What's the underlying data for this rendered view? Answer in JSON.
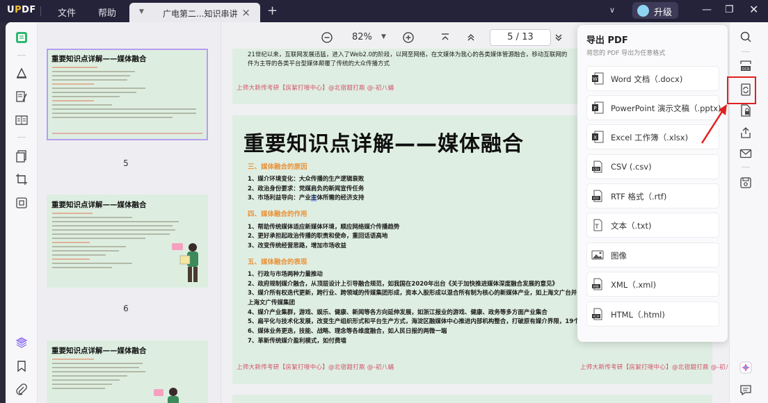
{
  "titlebar": {
    "logo": "UPDF",
    "menu": [
      "文件",
      "帮助"
    ],
    "tab_title": "广电第二...知识串讲",
    "upgrade_label": "升级"
  },
  "toolbar": {
    "zoom": "82%",
    "page_current": "5",
    "page_sep": "/",
    "page_total": "13"
  },
  "thumbnails": {
    "title": "重要知识点详解——媒体融合",
    "pages": [
      "5",
      "6"
    ]
  },
  "page_top": {
    "line1": "21世纪以来，互联网发展迅猛，进入了Web2.0的阶段，以网至网络，在文媒体为我心的各类媒体管源融合，移动互联网的",
    "line2": "件为主导的各类平台型媒体颠覆了传统的大众传播方式",
    "watermark": "上师大新传考研【房絮打嗖中心】@北宿甜打鼎 @-初八蛹"
  },
  "page_main": {
    "title": "重要知识点详解——媒体融合",
    "section1": "三、媒体融合的原因",
    "s1_items": [
      "1、媒介环境变化：大众传播的生产逻辑衰败",
      "2、政治身份要求：党媒肩负的新闻宣传任务",
      "3、市场利益导向：产业主体所需的经济支持"
    ],
    "section2": "四、媒体融合的作用",
    "s2_items": [
      "1、帮助传统媒体适应新媒体环境，顺应网络媒介传播趋势",
      "2、更好承担起政治传播的职责和使命，重回话语高地",
      "3、改变传统经营思路，增加市场收益"
    ],
    "section3": "五、媒体融合的表现",
    "s3_items": [
      "1、行政与市场两种力量推动",
      "2、政府规制媒介融合，从顶层设计上引导融合规范，如我国在2020年出台《关于加快推进媒体深度融合发展的意见》",
      "3、媒介所有权迭代更新，跨行业、跨领域的传媒集团形成，资本入股形成以混合所有制为核心的新媒体产业，如上海文广台并",
      "上海文广传媒集团",
      "4、媒介产业集群，游戏、娱乐、健康、新闻等各方向延伸发展，如浙江报业的游戏、健康、政务等多方面产业集合",
      "5、扁平化与技术化发展，改变生产组织形式和平台生产方式，海淀区融媒体中心推进内部机构整合，打破原有媒介界限，19个",
      "6、媒体业务更迭，技能、战略、理念等各维度融合，如人民日报的两微一端",
      "7、革新传统媒介盈利模式，如付费墙"
    ],
    "watermark": "上师大新传考研【房絮打嗖中心】@北宿甜打鼎 @-初八蛹"
  },
  "export_panel": {
    "title": "导出 PDF",
    "subtitle": "将您的 PDF 导出为任意格式",
    "items": [
      {
        "label": "Word 文档（.docx)",
        "icon": "word-icon",
        "color": "#2b5fc4"
      },
      {
        "label": "PowerPoint 演示文稿（.pptx)",
        "icon": "powerpoint-icon",
        "color": "#d2502a"
      },
      {
        "label": "Excel 工作簿（.xlsx)",
        "icon": "excel-icon",
        "color": "#1e7b45"
      },
      {
        "label": "CSV (.csv)",
        "icon": "csv-icon",
        "color": "#444444"
      },
      {
        "label": "RTF 格式（.rtf)",
        "icon": "rtf-icon",
        "color": "#444444"
      },
      {
        "label": "文本（.txt)",
        "icon": "text-icon",
        "color": "#444444"
      },
      {
        "label": "图像",
        "icon": "image-icon",
        "color": "#444444"
      },
      {
        "label": "XML（.xml)",
        "icon": "xml-icon",
        "color": "#444444"
      },
      {
        "label": "HTML（.html)",
        "icon": "html-icon",
        "color": "#444444"
      }
    ]
  },
  "colors": {
    "accent": "#8a6cf0",
    "highlight_box": "#e02020",
    "page_bg": "#dfeee2",
    "section_orange": "#e9933a",
    "watermark": "#d0506a"
  }
}
